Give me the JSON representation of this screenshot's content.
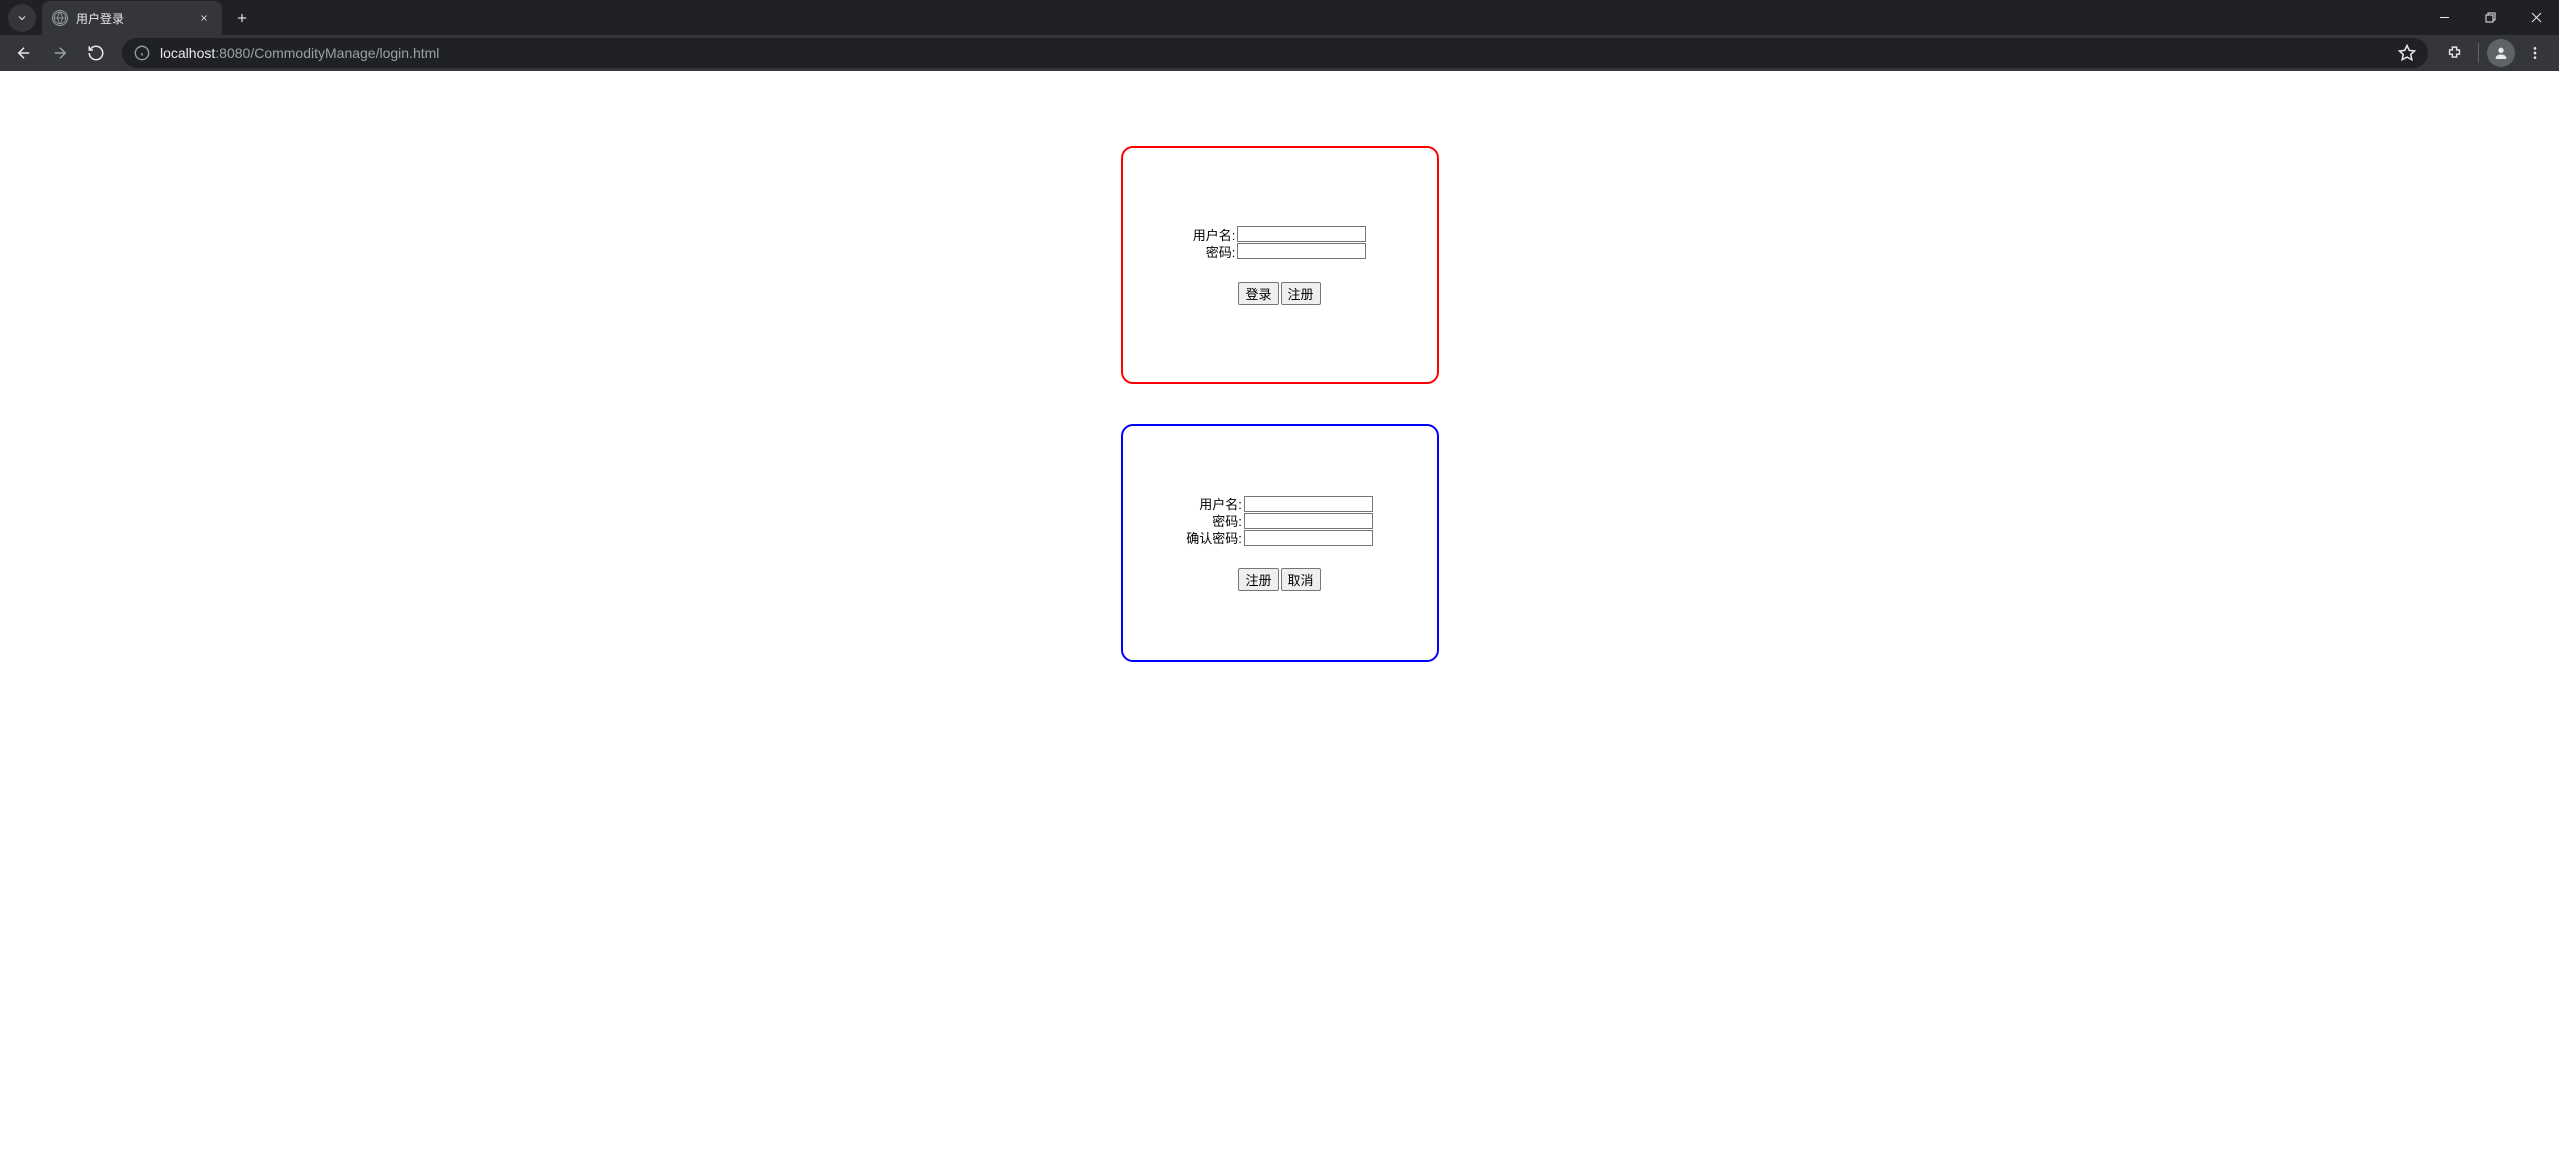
{
  "browser": {
    "tab_title": "用户登录",
    "url_host": "localhost",
    "url_port": ":8080",
    "url_path": "/CommodityManage/login.html"
  },
  "login_panel": {
    "username_label": "用户名:",
    "password_label": "密码:",
    "login_btn": "登录",
    "register_btn": "注册"
  },
  "register_panel": {
    "username_label": "用户名:",
    "password_label": "密码:",
    "confirm_password_label": "确认密码:",
    "register_btn": "注册",
    "cancel_btn": "取消"
  },
  "colors": {
    "login_border": "#ff0000",
    "register_border": "#0000ff"
  }
}
